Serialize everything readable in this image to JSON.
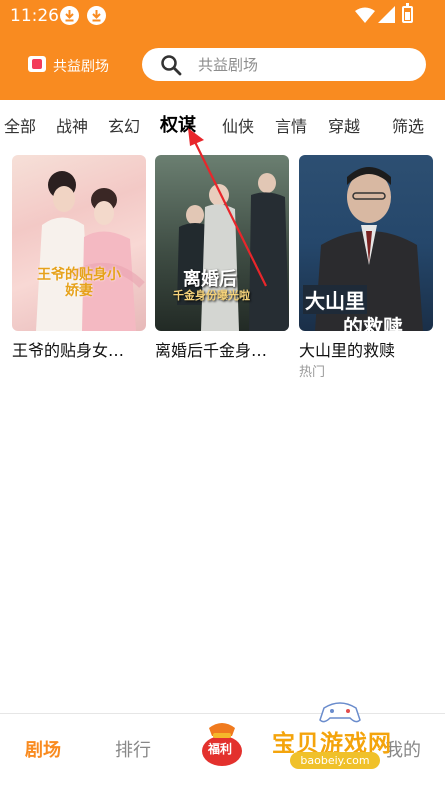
{
  "status_bar": {
    "time": "11:26"
  },
  "app": {
    "name": "共益剧场"
  },
  "search": {
    "placeholder": "共益剧场"
  },
  "tabs": [
    {
      "label": "全部"
    },
    {
      "label": "战神"
    },
    {
      "label": "玄幻"
    },
    {
      "label": "权谋",
      "active": true
    },
    {
      "label": "仙侠"
    },
    {
      "label": "言情"
    },
    {
      "label": "穿越"
    }
  ],
  "filter_label": "筛选",
  "cards": [
    {
      "title": "王爷的贴身女…",
      "poster_text": "王爷的贴身小娇妻",
      "tag": ""
    },
    {
      "title": "离婚后千金身…",
      "poster_text_line1": "离婚后",
      "poster_text_line2": "千金身份曝光啦",
      "tag": ""
    },
    {
      "title": "大山里的救赎",
      "poster_text_line1": "大山里",
      "poster_text_line2": "的救赎",
      "tag": "热门"
    }
  ],
  "bottom_nav": {
    "theater": "剧场",
    "ranking": "排行",
    "welfare": "福利",
    "mine": "我的"
  },
  "watermark": {
    "title": "宝贝游戏网",
    "url": "baobeiy.com"
  },
  "colors": {
    "brand": "#f98b20",
    "annotation": "#e8262b"
  }
}
